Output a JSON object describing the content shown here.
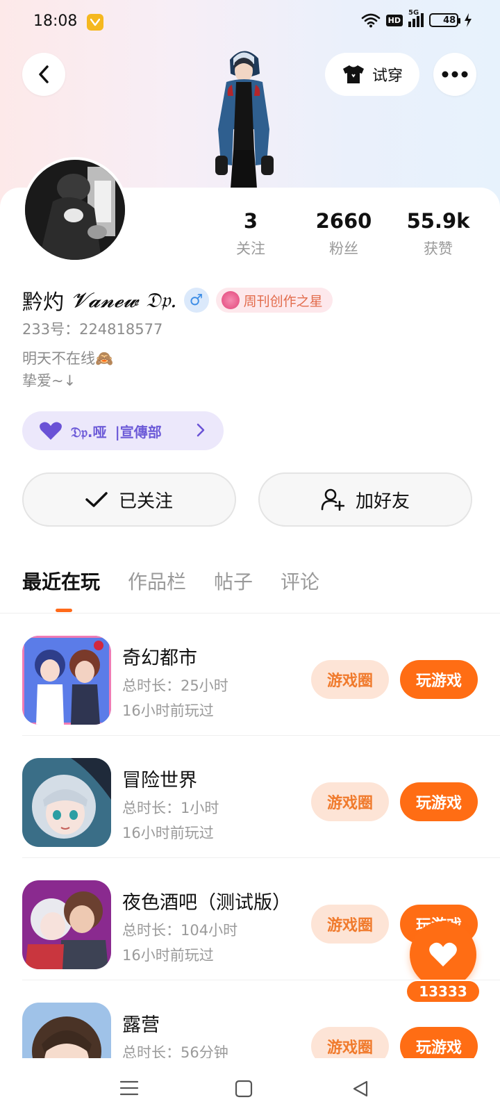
{
  "status_bar": {
    "time": "18:08",
    "network": "5G",
    "hd": "HD",
    "battery": "48",
    "battery_level": 0.48
  },
  "header": {
    "try_on_label": "试穿"
  },
  "profile": {
    "username": "黔灼",
    "username_signature": "𝓥𝓪𝓷𝓮𝔀 𝔇𝔭.",
    "gender": "♂",
    "honor_badge": "周刊创作之星",
    "uid": "233号：224818577",
    "bio": "明天不在线🙈\n挚爱~↓",
    "group_pill": {
      "name": "𝔇𝔭.哑",
      "department": "|宣傳部"
    }
  },
  "stats": [
    {
      "value": "3",
      "label": "关注"
    },
    {
      "value": "2660",
      "label": "粉丝"
    },
    {
      "value": "55.9k",
      "label": "获赞"
    }
  ],
  "actions": {
    "followed_label": "已关注",
    "add_friend_label": "加好友"
  },
  "tabs": [
    {
      "label": "最近在玩",
      "active": true
    },
    {
      "label": "作品栏",
      "active": false
    },
    {
      "label": "帖子",
      "active": false
    },
    {
      "label": "评论",
      "active": false
    }
  ],
  "games": [
    {
      "title": "奇幻都市",
      "duration": "总时长：25小时",
      "last_played": "16小时前玩过",
      "circle_label": "游戏圈",
      "play_label": "玩游戏"
    },
    {
      "title": "冒险世界",
      "duration": "总时长：1小时",
      "last_played": "16小时前玩过",
      "circle_label": "游戏圈",
      "play_label": "玩游戏"
    },
    {
      "title": "夜色酒吧（测试版）",
      "duration": "总时长：104小时",
      "last_played": "16小时前玩过",
      "circle_label": "游戏圈",
      "play_label": "玩游戏"
    },
    {
      "title": "露营",
      "duration": "总时长：56分钟",
      "last_played": "",
      "circle_label": "游戏圈",
      "play_label": "玩游戏"
    }
  ],
  "like_fab": {
    "count": "13333"
  },
  "colors": {
    "accent": "#ff6d14",
    "circle_bg": "#fde4d6",
    "group_pill_bg": "#ece8fb",
    "group_pill_text": "#6d5bd8"
  }
}
